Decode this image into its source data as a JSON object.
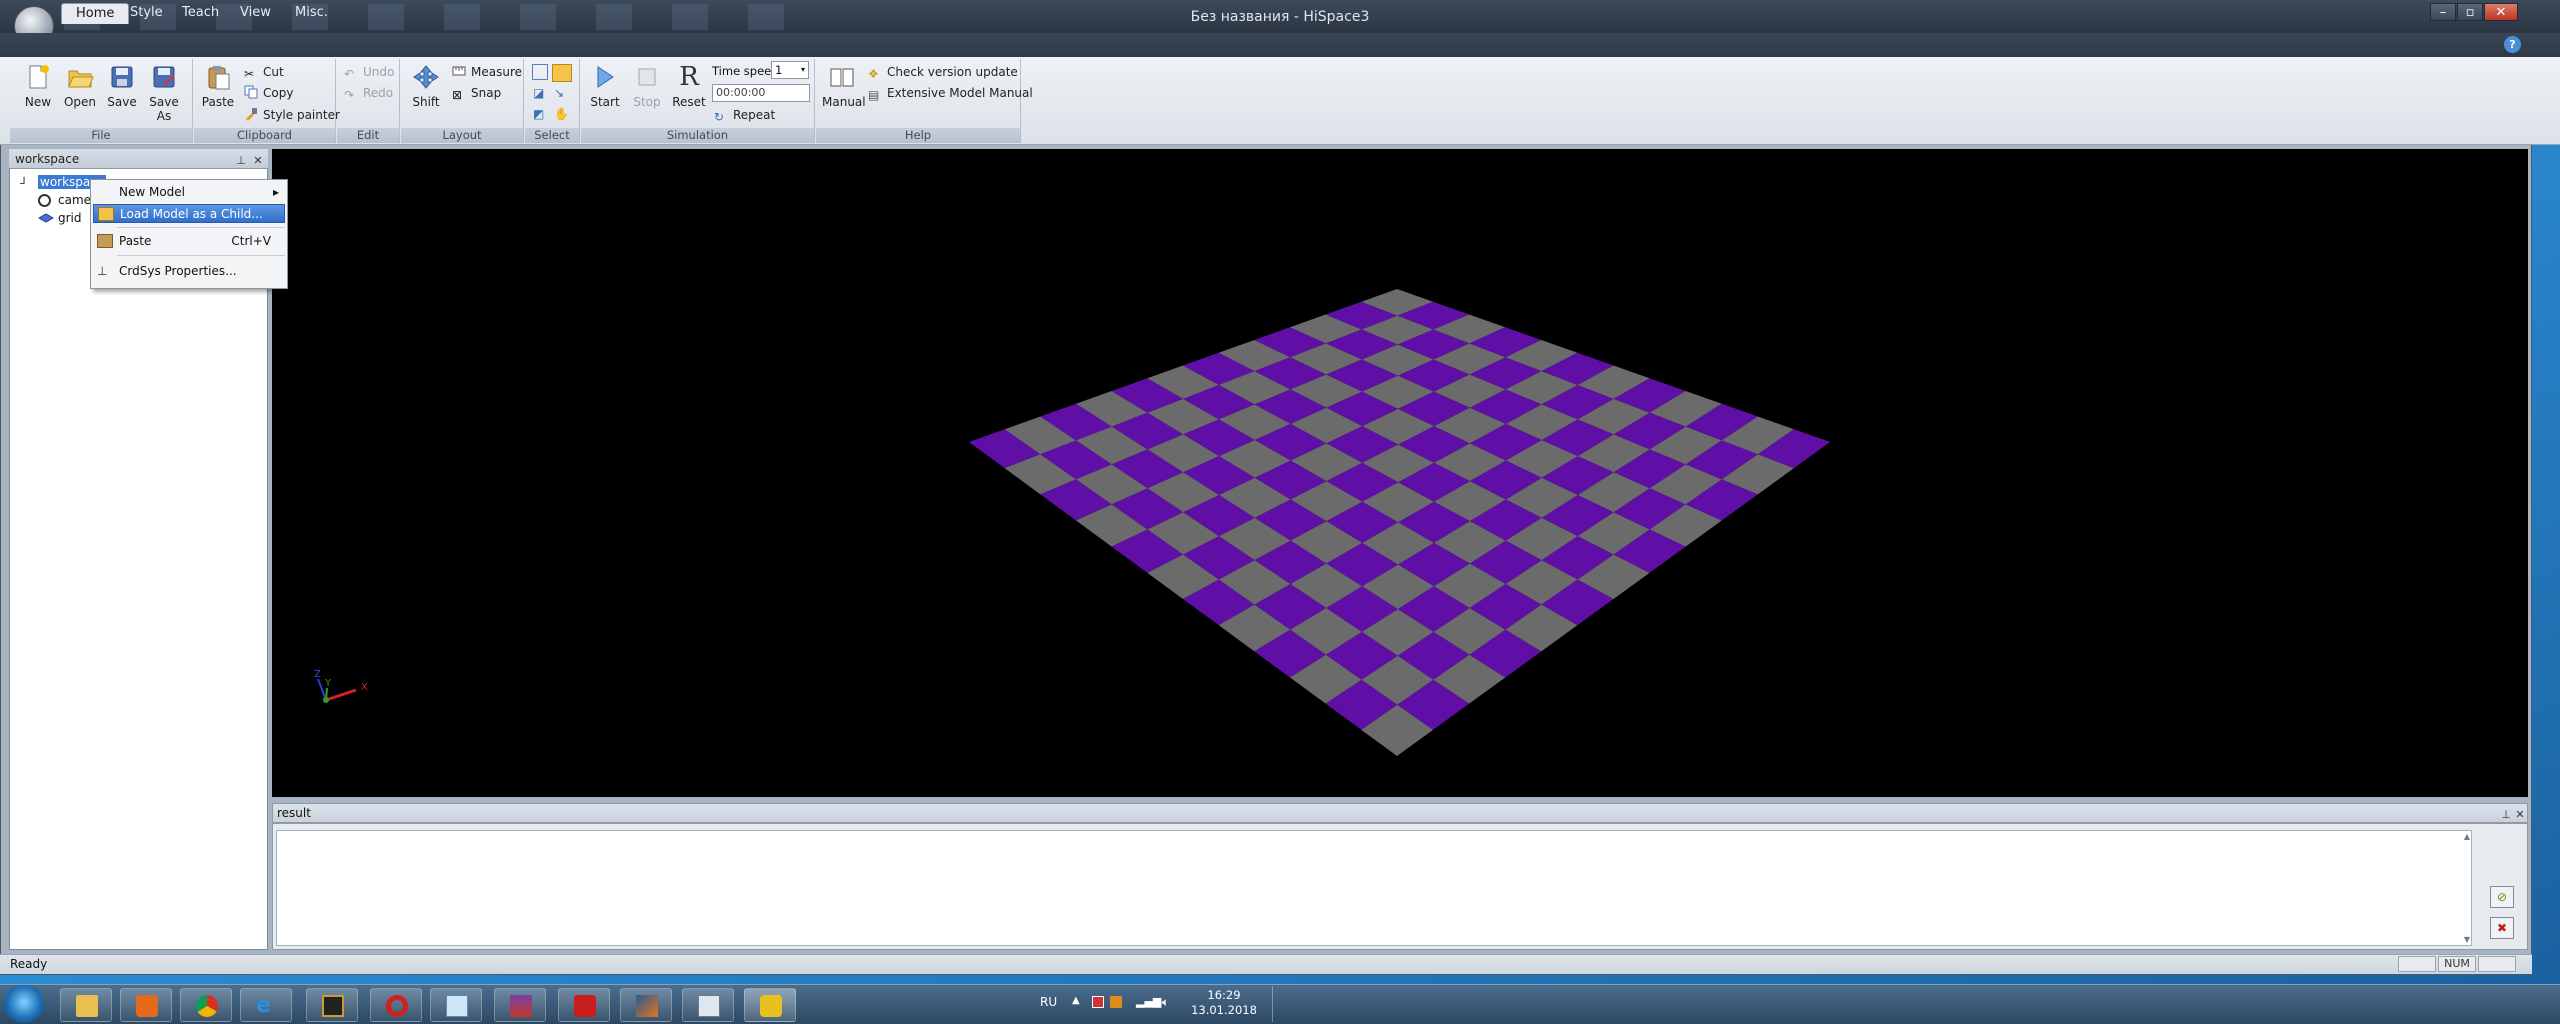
{
  "window": {
    "title": "Без названия - HiSpace3",
    "controls": {
      "minimize": "–",
      "maximize": "▫",
      "close": "✕"
    }
  },
  "tabs": [
    "Home",
    "Style",
    "Teach",
    "View",
    "Misc."
  ],
  "ribbon": {
    "file": {
      "label": "File",
      "new": "New",
      "open": "Open",
      "save": "Save",
      "save_as_1": "Save",
      "save_as_2": "As"
    },
    "clipboard": {
      "label": "Clipboard",
      "paste": "Paste",
      "cut": "Cut",
      "copy": "Copy",
      "style_painter": "Style painter"
    },
    "edit": {
      "label": "Edit",
      "undo": "Undo",
      "redo": "Redo"
    },
    "layout": {
      "label": "Layout",
      "shift": "Shift",
      "measure": "Measure",
      "snap": "Snap"
    },
    "select": {
      "label": "Select"
    },
    "simulation": {
      "label": "Simulation",
      "start": "Start",
      "stop": "Stop",
      "reset": "Reset",
      "time_speed_label": "Time speed",
      "time_speed_value": "1",
      "time_value": "00:00:00",
      "repeat": "Repeat"
    },
    "help": {
      "label": "Help",
      "manual": "Manual",
      "check_update": "Check version update",
      "model_manual": "Extensive Model Manual"
    }
  },
  "workspace_panel": {
    "title": "workspace",
    "tree": [
      {
        "label": "workspace",
        "selected": true
      },
      {
        "label": "camer"
      },
      {
        "label": "grid"
      }
    ]
  },
  "context_menu": {
    "items": [
      {
        "label": "New Model",
        "submenu": "▸"
      },
      {
        "label": "Load Model as a Child...",
        "highlighted": true
      },
      {
        "label": "Paste",
        "shortcut": "Ctrl+V"
      },
      {
        "label": "CrdSys Properties..."
      }
    ]
  },
  "viewport": {
    "axis_labels": {
      "z": "Z",
      "y": "Y",
      "x": "X"
    },
    "colors": {
      "tile_a": "#5f0fa5",
      "tile_b": "#6b6b6b",
      "background": "#000000"
    }
  },
  "result_panel": {
    "title": "result"
  },
  "status": {
    "text": "Ready",
    "num": "NUM"
  },
  "taskbar": {
    "language": "RU",
    "time": "16:29",
    "date": "13.01.2018"
  }
}
